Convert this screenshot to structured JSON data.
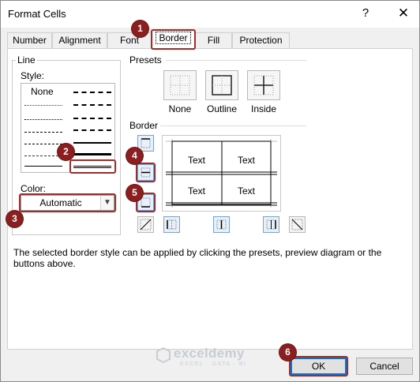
{
  "window": {
    "title": "Format Cells",
    "help_glyph": "?",
    "close_glyph": "✕"
  },
  "tabs": [
    {
      "label": "Number"
    },
    {
      "label": "Alignment"
    },
    {
      "label": "Font"
    },
    {
      "label": "Border",
      "active": true
    },
    {
      "label": "Fill"
    },
    {
      "label": "Protection"
    }
  ],
  "line": {
    "group_label": "Line",
    "style_label": "Style:",
    "none_label": "None",
    "color_label": "Color:",
    "color_value": "Automatic"
  },
  "presets": {
    "group_label": "Presets",
    "none_label": "None",
    "outline_label": "Outline",
    "inside_label": "Inside"
  },
  "border": {
    "group_label": "Border",
    "preview_cells": [
      "Text",
      "Text",
      "Text",
      "Text"
    ]
  },
  "description": "The selected border style can be applied by clicking the presets, preview diagram or the buttons above.",
  "watermark": {
    "name": "exceldemy",
    "tagline": "EXCEL · DATA · BI"
  },
  "buttons": {
    "ok": "OK",
    "cancel": "Cancel"
  },
  "badges": [
    "1",
    "2",
    "3",
    "4",
    "5",
    "6"
  ],
  "colors": {
    "highlight": "#a52a2a",
    "badge": "#8b1f1f",
    "accent_blue": "#0078d7"
  }
}
